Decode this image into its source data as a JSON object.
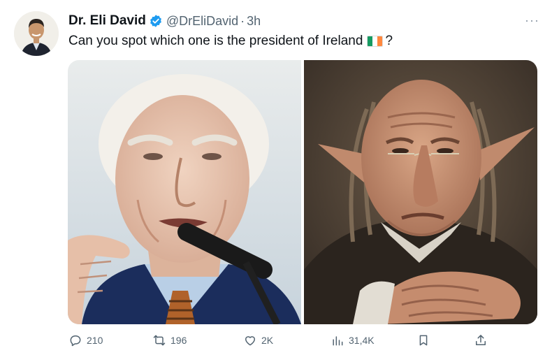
{
  "tweet": {
    "author_name": "Dr. Eli David",
    "handle": "@DrEliDavid",
    "separator": "·",
    "time": "3h",
    "text": "Can you spot which one is the president of Ireland",
    "text_suffix": "?",
    "more_label": "···",
    "flag_colors": [
      "#169b62",
      "#ffffff",
      "#ff883e"
    ],
    "verified_color": "#1d9bf0"
  },
  "actions": {
    "replies": "210",
    "retweets": "196",
    "likes": "2K",
    "views": "31,4K"
  },
  "icons": [
    "reply-icon",
    "retweet-icon",
    "like-icon",
    "views-icon",
    "bookmark-icon",
    "share-icon",
    "verified-badge-icon",
    "more-icon"
  ]
}
